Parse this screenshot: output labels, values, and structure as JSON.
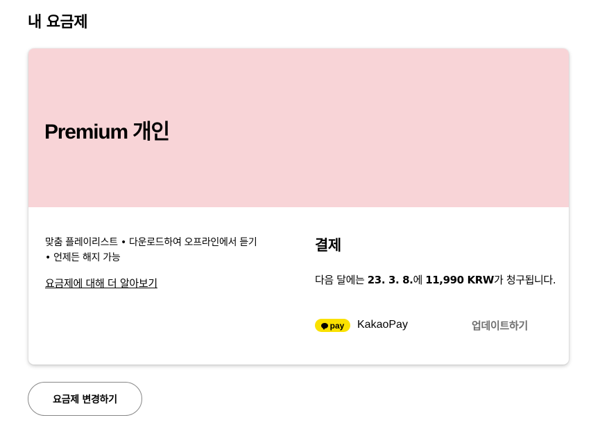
{
  "page": {
    "title": "내 요금제"
  },
  "plan": {
    "name": "Premium 개인",
    "hero_color": "#f8d4d7",
    "features_line1": "맞춤 플레이리스트 • 다운로드하여 오프라인에서 듣기",
    "features_line2": "• 언제든 해지 가능",
    "learn_more": "요금제에 대해 더 알아보기"
  },
  "payment": {
    "title": "결제",
    "billing_prefix": "다음 달에는 ",
    "billing_date": "23. 3. 8.",
    "billing_mid": "에 ",
    "billing_amount": "11,990 KRW",
    "billing_suffix": "가 청구됩니다.",
    "method_badge": "pay",
    "method_badge_icon": "kakao-speech-bubble-icon",
    "method_badge_color": "#fae100",
    "method_name": "KakaoPay",
    "update_link": "업데이트하기"
  },
  "actions": {
    "change_plan": "요금제 변경하기"
  }
}
